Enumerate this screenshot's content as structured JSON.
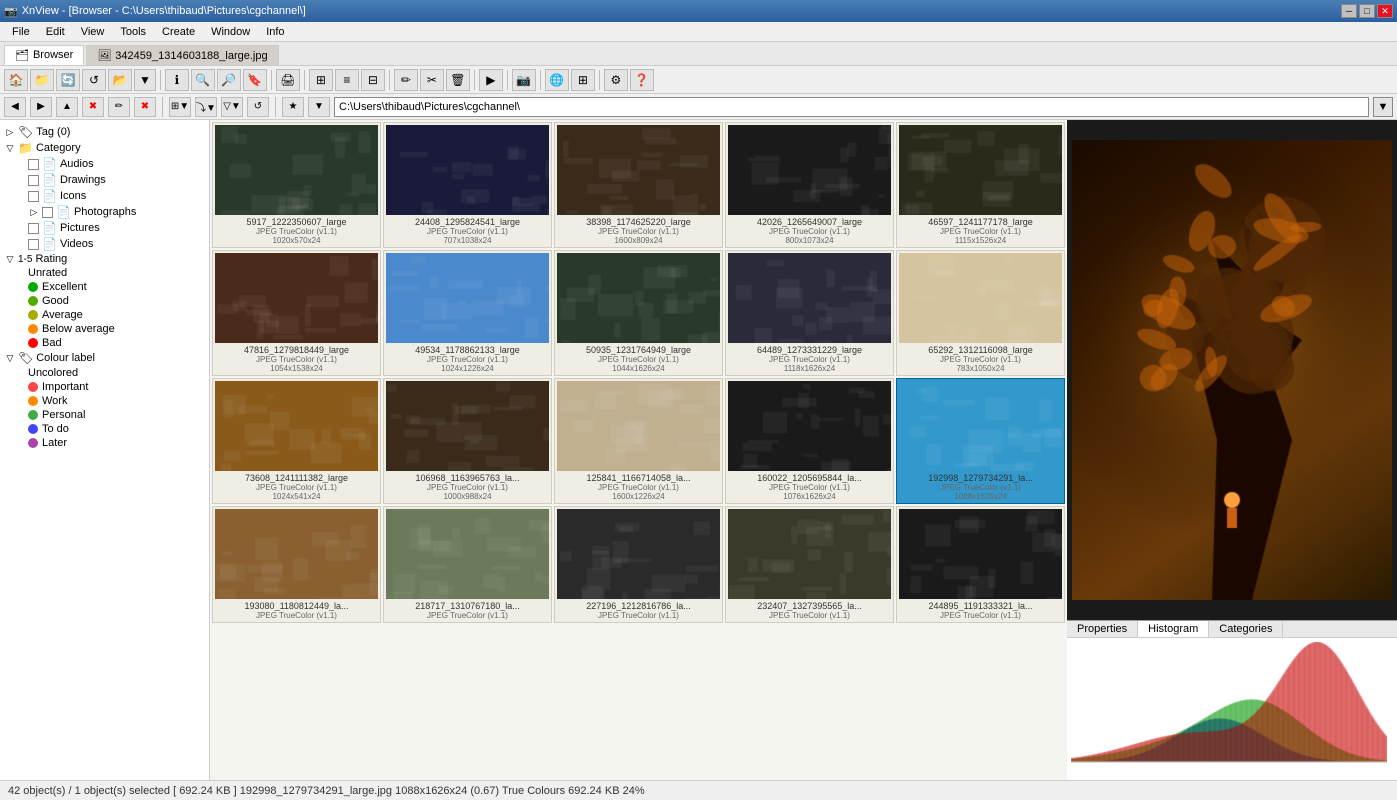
{
  "titlebar": {
    "title": "XnView - [Browser - C:\\Users\\thibaud\\Pictures\\cgchannel\\]",
    "icon": "📷",
    "controls": [
      "─",
      "□",
      "✕"
    ]
  },
  "menubar": {
    "items": [
      "File",
      "Edit",
      "View",
      "Tools",
      "Create",
      "Window",
      "Info"
    ]
  },
  "tabs": [
    {
      "label": "Browser",
      "active": true
    },
    {
      "label": "342459_1314603188_large.jpg",
      "active": false
    }
  ],
  "addressbar": {
    "path": "C:\\Users\\thibaud\\Pictures\\cgchannel\\"
  },
  "sidebar": {
    "tag_label": "Tag (0)",
    "category_label": "Category",
    "items": [
      {
        "id": "audios",
        "label": "Audios",
        "indent": 2,
        "has_checkbox": true
      },
      {
        "id": "drawings",
        "label": "Drawings",
        "indent": 2,
        "has_checkbox": true
      },
      {
        "id": "icons",
        "label": "Icons",
        "indent": 2,
        "has_checkbox": true
      },
      {
        "id": "photographs",
        "label": "Photographs",
        "indent": 2,
        "has_checkbox": true
      },
      {
        "id": "pictures",
        "label": "Pictures",
        "indent": 2,
        "has_checkbox": true
      },
      {
        "id": "videos",
        "label": "Videos",
        "indent": 2,
        "has_checkbox": true
      }
    ],
    "rating_label": "Rating",
    "rating_items": [
      {
        "id": "unrated",
        "label": "Unrated",
        "color": null
      },
      {
        "id": "excellent",
        "label": "Excellent",
        "color": "#00aa00"
      },
      {
        "id": "good",
        "label": "Good",
        "color": "#55aa00"
      },
      {
        "id": "average",
        "label": "Average",
        "color": "#aaaa00"
      },
      {
        "id": "below_average",
        "label": "Below average",
        "color": "#ff8800"
      },
      {
        "id": "bad",
        "label": "Bad",
        "color": "#ff0000"
      }
    ],
    "colour_label": "Colour label",
    "colour_items": [
      {
        "id": "uncolored",
        "label": "Uncolored",
        "color": null
      },
      {
        "id": "important",
        "label": "Important",
        "color": "#ff4444"
      },
      {
        "id": "work",
        "label": "Work",
        "color": "#ff8800"
      },
      {
        "id": "personal",
        "label": "Personal",
        "color": "#44aa44"
      },
      {
        "id": "todo",
        "label": "To do",
        "color": "#4444ff"
      },
      {
        "id": "later",
        "label": "Later",
        "color": "#aa44aa"
      }
    ]
  },
  "files": [
    {
      "name": "5917_1222350607_large",
      "type": "JPEG TrueColor (v1.1)",
      "dims": "1020x570x24",
      "thumb_color": "#2a3a2a",
      "selected": false
    },
    {
      "name": "24408_1295824541_large",
      "type": "JPEG TrueColor (v1.1)",
      "dims": "707x1038x24",
      "thumb_color": "#1a1a3a",
      "selected": false
    },
    {
      "name": "38398_1174625220_large",
      "type": "JPEG TrueColor (v1.1)",
      "dims": "1600x809x24",
      "thumb_color": "#3a2a1a",
      "selected": false
    },
    {
      "name": "42026_1265649007_large",
      "type": "JPEG TrueColor (v1.1)",
      "dims": "800x1073x24",
      "thumb_color": "#1a1a1a",
      "selected": false
    },
    {
      "name": "46597_1241177178_large",
      "type": "JPEG TrueColor (v1.1)",
      "dims": "1115x1526x24",
      "thumb_color": "#2a2a1a",
      "selected": false
    },
    {
      "name": "47816_1279818449_large",
      "type": "JPEG TrueColor (v1.1)",
      "dims": "1054x1538x24",
      "thumb_color": "#4a2a1a",
      "selected": false
    },
    {
      "name": "49534_1178862133_large",
      "type": "JPEG TrueColor (v1.1)",
      "dims": "1024x1226x24",
      "thumb_color": "#4a8acc",
      "selected": false
    },
    {
      "name": "50935_1231764949_large",
      "type": "JPEG TrueColor (v1.1)",
      "dims": "1044x1626x24",
      "thumb_color": "#2a3a2a",
      "selected": false
    },
    {
      "name": "64489_1273331229_large",
      "type": "JPEG TrueColor (v1.1)",
      "dims": "1118x1626x24",
      "thumb_color": "#2a2a3a",
      "selected": false
    },
    {
      "name": "65292_1312116098_large",
      "type": "JPEG TrueColor (v1.1)",
      "dims": "783x1050x24",
      "thumb_color": "#d4c4a0",
      "selected": false
    },
    {
      "name": "73608_1241111382_large",
      "type": "JPEG TrueColor (v1.1)",
      "dims": "1024x541x24",
      "thumb_color": "#8a5a1a",
      "selected": false
    },
    {
      "name": "106968_1163965763_la...",
      "type": "JPEG TrueColor (v1.1)",
      "dims": "1000x988x24",
      "thumb_color": "#3a2a1a",
      "selected": false
    },
    {
      "name": "125841_1166714058_la...",
      "type": "JPEG TrueColor (v1.1)",
      "dims": "1600x1226x24",
      "thumb_color": "#c0b090",
      "selected": false
    },
    {
      "name": "160022_1205695844_la...",
      "type": "JPEG TrueColor (v1.1)",
      "dims": "1076x1626x24",
      "thumb_color": "#1a1a1a",
      "selected": false
    },
    {
      "name": "192998_1279734291_la...",
      "type": "JPEG TrueColor (v1.1)",
      "dims": "1088x1626x24",
      "thumb_color": "#3399cc",
      "selected": true
    },
    {
      "name": "193080_1180812449_la...",
      "type": "JPEG TrueColor (v1.1)",
      "dims": "",
      "thumb_color": "#8a6030",
      "selected": false
    },
    {
      "name": "218717_1310767180_la...",
      "type": "JPEG TrueColor (v1.1)",
      "dims": "",
      "thumb_color": "#6a7a5a",
      "selected": false
    },
    {
      "name": "227196_1212816786_la...",
      "type": "JPEG TrueColor (v1.1)",
      "dims": "",
      "thumb_color": "#2a2a2a",
      "selected": false
    },
    {
      "name": "232407_1327395565_la...",
      "type": "JPEG TrueColor (v1.1)",
      "dims": "",
      "thumb_color": "#3a3a2a",
      "selected": false
    },
    {
      "name": "244895_1191333321_la...",
      "type": "JPEG TrueColor (v1.1)",
      "dims": "",
      "thumb_color": "#1a1a1a",
      "selected": false
    }
  ],
  "preview_tabs": [
    {
      "label": "Properties",
      "active": false
    },
    {
      "label": "Histogram",
      "active": true
    },
    {
      "label": "Categories",
      "active": false
    }
  ],
  "statusbar": {
    "text": "42 object(s) / 1 object(s) selected  [ 692.24 KB ]  192998_1279734291_large.jpg  1088x1626x24 (0.67)  True Colours  692.24 KB  24%"
  },
  "histogram": {
    "note": "histogram chart area"
  }
}
